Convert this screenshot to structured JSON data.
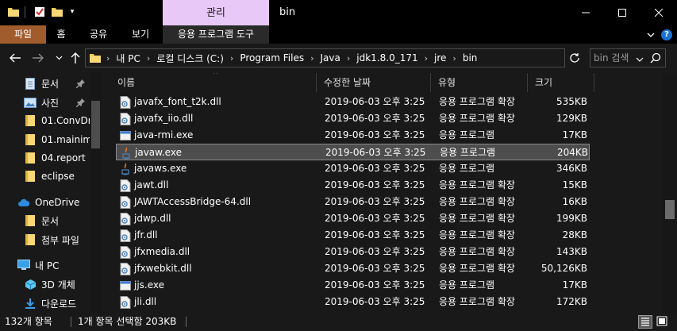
{
  "window": {
    "title": "bin",
    "manage_tab": "관리",
    "quick_access_menu_glyph": "▾"
  },
  "ribbon": {
    "tabs": [
      "파일",
      "홈",
      "공유",
      "보기",
      "응용 프로그램 도구"
    ],
    "help_glyph": "?"
  },
  "address": {
    "crumbs": [
      "내 PC",
      "로컬 디스크 (C:)",
      "Program Files",
      "Java",
      "jdk1.8.0_171",
      "jre",
      "bin"
    ],
    "separator": "›",
    "search_placeholder": "bin 검색"
  },
  "navpane": {
    "items": [
      {
        "label": "문서",
        "icon": "documents-icon",
        "pinned": true
      },
      {
        "label": "사진",
        "icon": "pictures-icon",
        "pinned": true
      },
      {
        "label": "01.ConvDr",
        "icon": "folder-icon",
        "pinned": false
      },
      {
        "label": "01.mainim",
        "icon": "folder-icon",
        "pinned": false
      },
      {
        "label": "04.report",
        "icon": "folder-icon",
        "pinned": false
      },
      {
        "label": "eclipse",
        "icon": "folder-icon",
        "pinned": false
      },
      {
        "label": "OneDrive",
        "icon": "cloud-icon",
        "pinned": false
      },
      {
        "label": "문서",
        "icon": "folder-icon",
        "pinned": false
      },
      {
        "label": "첨부 파일",
        "icon": "folder-icon",
        "pinned": false
      },
      {
        "label": "내 PC",
        "icon": "computer-icon",
        "pinned": false
      },
      {
        "label": "3D 개체",
        "icon": "3d-objects-icon",
        "pinned": false
      },
      {
        "label": "다운로드",
        "icon": "downloads-icon",
        "pinned": false
      }
    ]
  },
  "columns": {
    "name": "이름",
    "date": "수정한 날짜",
    "type": "유형",
    "size": "크기"
  },
  "files": [
    {
      "name": "javafx_font_t2k.dll",
      "date": "2019-06-03 오후 3:25",
      "type": "응용 프로그램 확장",
      "size": "535KB",
      "icon": "dll-icon",
      "selected": false
    },
    {
      "name": "javafx_iio.dll",
      "date": "2019-06-03 오후 3:25",
      "type": "응용 프로그램 확장",
      "size": "129KB",
      "icon": "dll-icon",
      "selected": false
    },
    {
      "name": "java-rmi.exe",
      "date": "2019-06-03 오후 3:25",
      "type": "응용 프로그램",
      "size": "17KB",
      "icon": "exe-icon",
      "selected": false
    },
    {
      "name": "javaw.exe",
      "date": "2019-06-03 오후 3:25",
      "type": "응용 프로그램",
      "size": "204KB",
      "icon": "java-icon",
      "selected": true
    },
    {
      "name": "javaws.exe",
      "date": "2019-06-03 오후 3:25",
      "type": "응용 프로그램",
      "size": "346KB",
      "icon": "java-icon",
      "selected": false
    },
    {
      "name": "jawt.dll",
      "date": "2019-06-03 오후 3:25",
      "type": "응용 프로그램 확장",
      "size": "15KB",
      "icon": "dll-icon",
      "selected": false
    },
    {
      "name": "JAWTAccessBridge-64.dll",
      "date": "2019-06-03 오후 3:25",
      "type": "응용 프로그램 확장",
      "size": "16KB",
      "icon": "dll-icon",
      "selected": false
    },
    {
      "name": "jdwp.dll",
      "date": "2019-06-03 오후 3:25",
      "type": "응용 프로그램 확장",
      "size": "199KB",
      "icon": "dll-icon",
      "selected": false
    },
    {
      "name": "jfr.dll",
      "date": "2019-06-03 오후 3:25",
      "type": "응용 프로그램 확장",
      "size": "28KB",
      "icon": "dll-icon",
      "selected": false
    },
    {
      "name": "jfxmedia.dll",
      "date": "2019-06-03 오후 3:25",
      "type": "응용 프로그램 확장",
      "size": "143KB",
      "icon": "dll-icon",
      "selected": false
    },
    {
      "name": "jfxwebkit.dll",
      "date": "2019-06-03 오후 3:25",
      "type": "응용 프로그램 확장",
      "size": "50,126KB",
      "icon": "dll-icon",
      "selected": false
    },
    {
      "name": "jjs.exe",
      "date": "2019-06-03 오후 3:25",
      "type": "응용 프로그램",
      "size": "17KB",
      "icon": "exe-icon",
      "selected": false
    },
    {
      "name": "jli.dll",
      "date": "2019-06-03 오후 3:25",
      "type": "응용 프로그램 확장",
      "size": "172KB",
      "icon": "dll-icon",
      "selected": false
    }
  ],
  "status": {
    "item_count": "132개 항목",
    "selection": "1개 항목 선택함 203KB"
  },
  "colors": {
    "background": "#191919",
    "manage_tab": "#e8c8f7",
    "file_tab": "#a15c2e",
    "selection": "#4d4d4d",
    "folder": "#f5c84b"
  }
}
